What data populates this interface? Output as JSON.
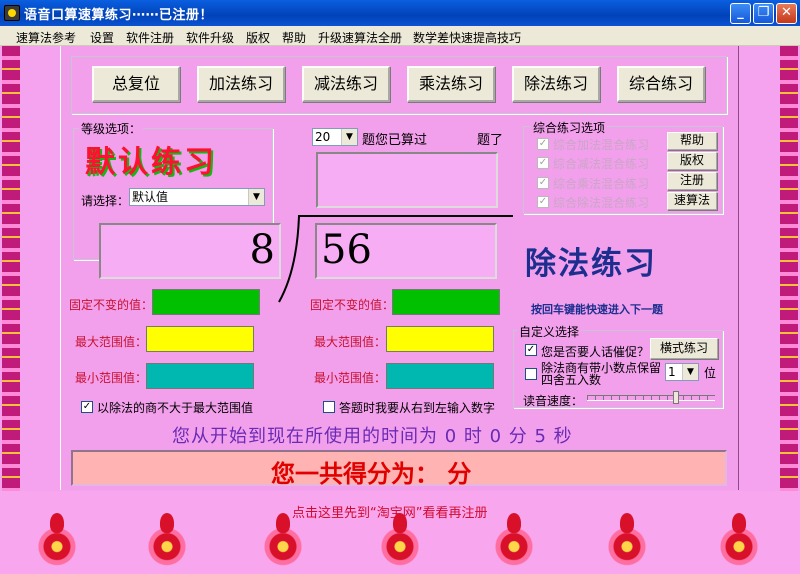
{
  "window": {
    "title": "语音口算速算练习⋯⋯已注册！",
    "minimize": "_",
    "maximize": "❐",
    "close": "✕"
  },
  "menu": [
    "速算法参考",
    "设置",
    "软件注册",
    "软件升级",
    "版权",
    "帮助",
    "升级速算法全册",
    "数学差快速提高技巧"
  ],
  "toolbar": [
    "总复位",
    "加法练习",
    "减法练习",
    "乘法练习",
    "除法练习",
    "综合练习"
  ],
  "level": {
    "group_title": "等级选项：",
    "mode_text": "默认练习",
    "select_label": "请选择：",
    "select_value": "默认值"
  },
  "count": {
    "value": "20",
    "label_before": "题您已算过",
    "label_after": "题了"
  },
  "mixed": {
    "group_title": "综合练习选项",
    "options": [
      "综合加法混合练习",
      "综合减法混合练习",
      "综合乘法混合练习",
      "综合除法混合练习"
    ],
    "buttons": [
      "帮助",
      "版权",
      "注册",
      "速算法"
    ]
  },
  "problem": {
    "divisor": "8",
    "dividend": "56",
    "mode_banner": "除法练习",
    "hint": "按回车键能快速进入下一题"
  },
  "left_fields": {
    "fixed_label": "固定不变的值：",
    "max_label": "最大范围值：",
    "min_label": "最小范围值：",
    "checkbox_label": "以除法的商不大于最大范围值"
  },
  "right_fields": {
    "fixed_label": "固定不变的值：",
    "max_label": "最大范围值：",
    "min_label": "最小范围值：",
    "checkbox_label": "答题时我要从右到左输入数字"
  },
  "custom": {
    "group_title": "自定义选择",
    "urge_label": "您是否要人话催促？",
    "urge_checked": true,
    "mode_button": "横式练习",
    "decimal_label_line1": "除法商有带小数点保留",
    "decimal_label_line2": "四舍五入数",
    "decimal_value": "1",
    "decimal_unit": "位",
    "speed_label": "读音速度："
  },
  "timer_text": "您从开始到现在所使用的时间为 0 时 0 分 5 秒",
  "score_text": "您一共得分为：  分",
  "register_link": "点击这里先到“淘宝网”看看再注册",
  "colors": {
    "fixed": "#00c000",
    "max": "#ffff00",
    "min": "#00b8b0",
    "banner": "#1c2f8f",
    "score": "#e00000"
  }
}
